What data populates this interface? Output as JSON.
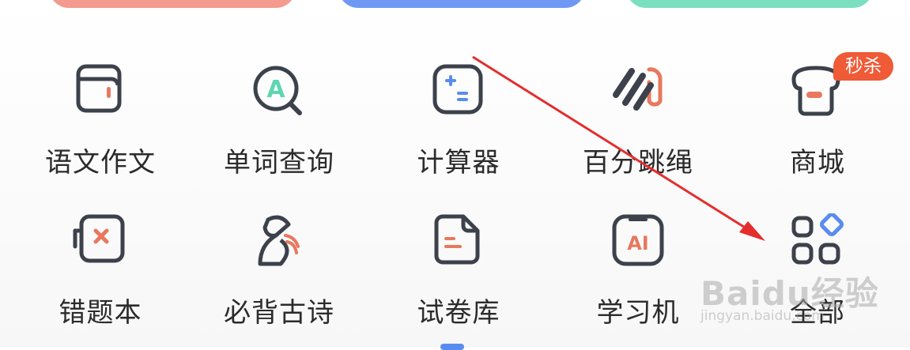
{
  "grid": {
    "row1": [
      {
        "label": "语文作文",
        "icon": "notebook-icon"
      },
      {
        "label": "单词查询",
        "icon": "word-search-icon"
      },
      {
        "label": "计算器",
        "icon": "calculator-icon"
      },
      {
        "label": "百分跳绳",
        "icon": "jump-rope-icon"
      },
      {
        "label": "商城",
        "icon": "shop-icon"
      }
    ],
    "row2": [
      {
        "label": "错题本",
        "icon": "wrong-question-icon"
      },
      {
        "label": "必背古诗",
        "icon": "poem-figure-icon"
      },
      {
        "label": "试卷库",
        "icon": "paper-icon"
      },
      {
        "label": "学习机",
        "icon": "ai-tablet-icon"
      },
      {
        "label": "全部",
        "icon": "all-apps-icon"
      }
    ]
  },
  "badge": {
    "text": "秒杀",
    "color": "#ef5a37"
  },
  "watermark": {
    "main": "Baidu经验",
    "sub": "jingyan.baidu.com"
  },
  "colors": {
    "accent_red": "#e8785f",
    "accent_blue": "#5a8cf0",
    "accent_green": "#5fd6b0",
    "icon_dark": "#3c414b",
    "arrow": "#e52d2d"
  }
}
